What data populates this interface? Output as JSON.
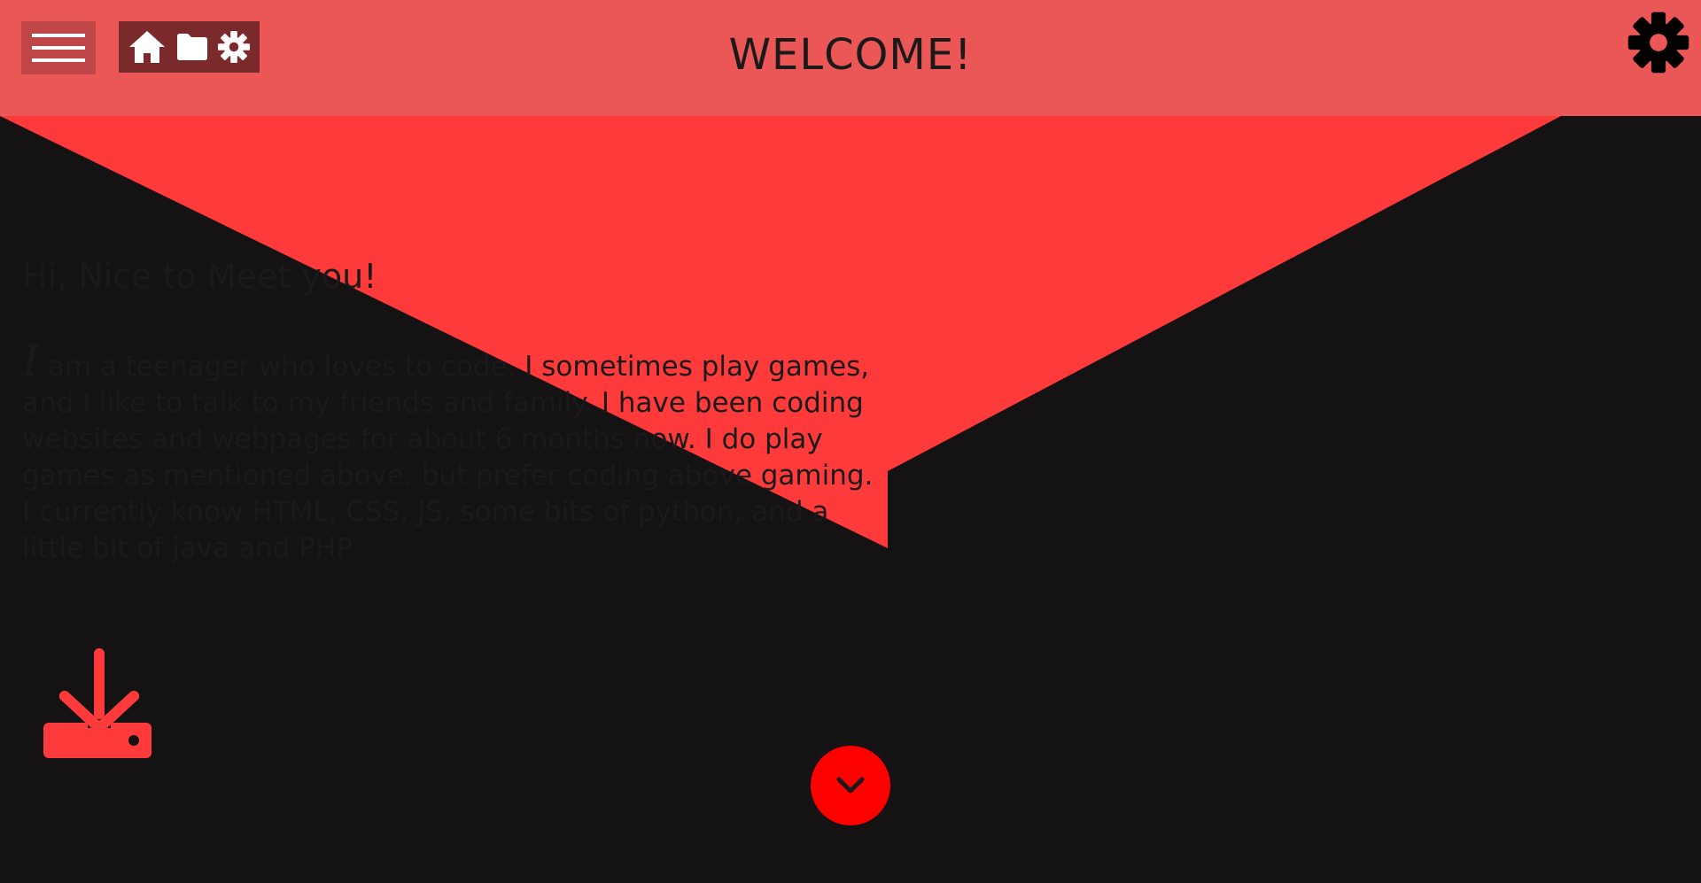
{
  "header": {
    "title": "WELCOME!"
  },
  "intro": {
    "heading": "Hi, Nice to Meet you!",
    "drop_cap": "I",
    "body": " am a teenager who loves to code. I sometimes play games, and I like to talk to my friends and family. I have been coding websites and webpages for about 6 months now. I do play games as mentioned above, but prefer coding above gaming. I currently know HTML, CSS, JS, some bits of python, and a little bit of java and PHP"
  },
  "icons": {
    "menu": "hamburger-menu-icon",
    "home": "home-icon",
    "folder": "folder-icon",
    "settings_small": "gear-icon",
    "settings_large": "gear-icon",
    "download": "download-icon",
    "scroll_down": "chevron-down-icon"
  },
  "colors": {
    "header_bg": "#eb5757",
    "panel_red": "#ff3a3a",
    "dark": "#141212",
    "scroll_button": "#ff0000"
  }
}
